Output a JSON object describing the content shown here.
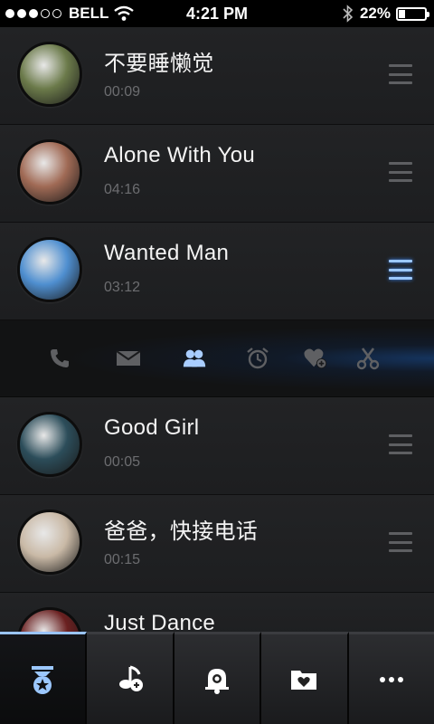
{
  "status_bar": {
    "carrier": "BELL",
    "time": "4:21 PM",
    "battery": "22%",
    "battery_level": 0.22,
    "signal_bars_filled": 3,
    "signal_bars_total": 5
  },
  "tracks": [
    {
      "title": "不要睡懒觉",
      "duration": "00:09",
      "avatar_color": "#6b7a4a"
    },
    {
      "title": "Alone With You",
      "duration": "04:16",
      "avatar_color": "#a06a55"
    },
    {
      "title": "Wanted Man",
      "duration": "03:12",
      "avatar_color": "#4f8fd0",
      "selected": true
    },
    {
      "title": "Good Girl",
      "duration": "00:05",
      "avatar_color": "#2c4d5a"
    },
    {
      "title": "爸爸，快接电话",
      "duration": "00:15",
      "avatar_color": "#c9b9a6"
    },
    {
      "title": "Just Dance",
      "avatar_color": "#6a2020"
    }
  ],
  "actions": [
    {
      "icon": "phone-icon"
    },
    {
      "icon": "envelope-icon"
    },
    {
      "icon": "contacts-icon",
      "active": true
    },
    {
      "icon": "alarm-clock-icon"
    },
    {
      "icon": "heart-add-icon"
    },
    {
      "icon": "scissors-icon"
    }
  ],
  "tabs": [
    {
      "icon": "ribbon-star-icon",
      "active": true
    },
    {
      "icon": "music-note-icon"
    },
    {
      "icon": "alarm-bell-icon"
    },
    {
      "icon": "folder-heart-icon"
    },
    {
      "icon": "more-icon"
    }
  ],
  "colors": {
    "accent": "#9cc8ff",
    "row_bg": "#222325",
    "muted_text": "#6c6d70"
  }
}
